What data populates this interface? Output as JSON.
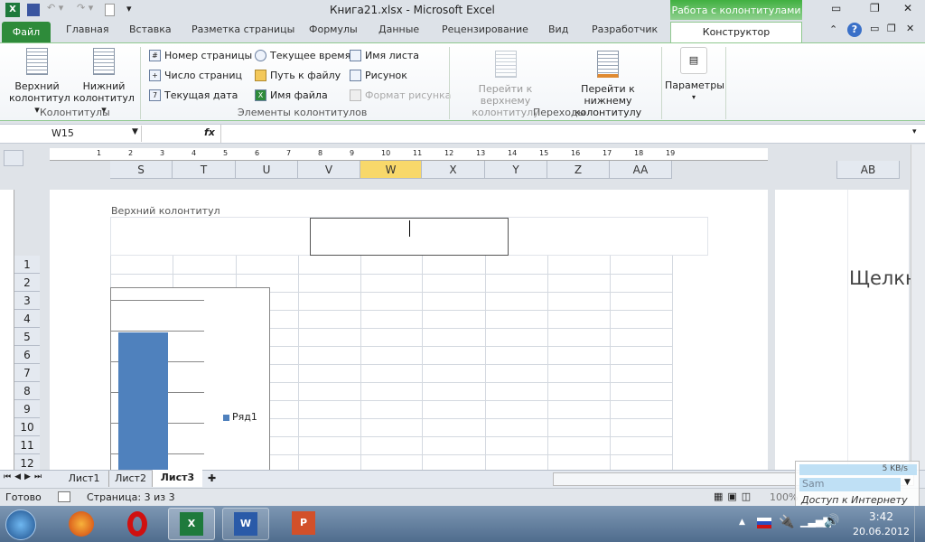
{
  "title": "Книга21.xlsx  -  Microsoft Excel",
  "context_tab": "Работа с колонтитулами",
  "tabs": [
    "Файл",
    "Главная",
    "Вставка",
    "Разметка страницы",
    "Формулы",
    "Данные",
    "Рецензирование",
    "Вид",
    "Разработчик",
    "Конструктор"
  ],
  "ribbon": {
    "header_btn": "Верхний колонтитул ▾",
    "footer_btn": "Нижний колонтитул ▾",
    "group1": "Колонтитулы",
    "elements": [
      "Номер страницы",
      "Число страниц",
      "Текущая дата",
      "Текущее время",
      "Путь к файлу",
      "Имя файла",
      "Имя листа",
      "Рисунок",
      "Формат рисунка"
    ],
    "group2": "Элементы колонтитулов",
    "goto_header": "Перейти к верхнему колонтитулу",
    "goto_footer": "Перейти к нижнему колонтитулу",
    "group3": "Переходы",
    "params": "Параметры"
  },
  "formula": {
    "name_box": "W15",
    "fx": "fx",
    "value": ""
  },
  "ruler": [
    "1",
    "2",
    "3",
    "4",
    "5",
    "6",
    "7",
    "8",
    "9",
    "10",
    "11",
    "12",
    "13",
    "14",
    "15",
    "16",
    "17",
    "18",
    "19"
  ],
  "columns": [
    "S",
    "T",
    "U",
    "V",
    "W",
    "X",
    "Y",
    "Z",
    "AA"
  ],
  "column_ab": "AB",
  "rows": [
    "1",
    "2",
    "3",
    "4",
    "5",
    "6",
    "7",
    "8",
    "9",
    "10",
    "11",
    "12"
  ],
  "header_label": "Верхний колонтитул",
  "next_page_text": "Щелкн",
  "chart_legend": "Ряд1",
  "sheets": [
    "Лист1",
    "Лист2",
    "Лист3"
  ],
  "status": {
    "ready": "Готово",
    "page": "Страница: 3 из 3",
    "zoom": "100%"
  },
  "net": {
    "speed": "5 KB/s",
    "name": "Sam",
    "state": "Доступ к Интернету"
  },
  "clock": {
    "time": "3:42",
    "date": "20.06.2012"
  },
  "colors": {
    "accent": "#217346",
    "bar": "#4f81bd",
    "file_tab": "#2e8b3a"
  }
}
